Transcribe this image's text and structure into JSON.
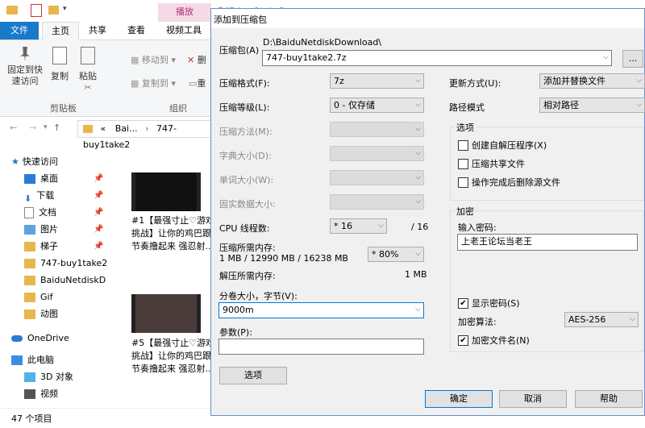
{
  "explorer": {
    "window_title": "747-buy1take2",
    "play_tab": "播放",
    "tabs": [
      "文件",
      "主页",
      "共享",
      "查看",
      "视频工具"
    ],
    "ribbon": {
      "pin": "固定到快\n速访问",
      "copy": "复制",
      "paste": "粘贴",
      "move_to": "移动到",
      "copy_to": "复制到",
      "delete": "删",
      "rename": "重",
      "group_clipboard": "剪贴板",
      "group_organize": "组织"
    },
    "address": [
      "«",
      "Bai...",
      "›",
      "747-buy1take2"
    ],
    "nav": {
      "quick_access": "快速访问",
      "items": [
        "桌面",
        "下载",
        "文档",
        "图片",
        "梯子",
        "747-buy1take2",
        "BaiduNetdiskD",
        "Gif",
        "动图"
      ],
      "onedrive": "OneDrive",
      "this_pc": "此电脑",
      "pc_items": [
        "3D 对象",
        "视频"
      ]
    },
    "files": [
      {
        "caption": "#1【最强寸止♡游戏挑战】让你的鸡巴跟着节奏撸起来 强忍射..."
      },
      {
        "caption": "#5【最强寸止♡游戏挑战】让你的鸡巴跟着节奏撸起来 强忍射..."
      }
    ],
    "status": "47 个项目",
    "colors": {
      "accent": "#1979ca",
      "play_tab_bg": "#f5d9e6",
      "play_tab_fg": "#b52d73"
    }
  },
  "dialog": {
    "title": "添加到压缩包",
    "archive_label": "压缩包(A)",
    "archive_path": "D:\\BaiduNetdiskDownload\\",
    "archive_name": "747-buy1take2.7z",
    "browse": "...",
    "format_label": "压缩格式(F):",
    "format_value": "7z",
    "level_label": "压缩等级(L):",
    "level_value": "0 - 仅存储",
    "method_label": "压缩方法(M):",
    "dict_label": "字典大小(D):",
    "word_label": "单词大小(W):",
    "solid_label": "固实数据大小:",
    "threads_label": "CPU 线程数:",
    "threads_value": "* 16",
    "threads_max": "/ 16",
    "mem_comp_label": "压缩所需内存:",
    "mem_comp_value": "1 MB / 12990 MB / 16238 MB",
    "mem_percent": "* 80%",
    "mem_decomp_label": "解压所需内存:",
    "mem_decomp_value": "1 MB",
    "split_label": "分卷大小，字节(V):",
    "split_value": "9000m",
    "params_label": "参数(P):",
    "params_value": "",
    "options_button": "选项",
    "update_label": "更新方式(U):",
    "update_value": "添加并替换文件",
    "path_label": "路径模式",
    "path_value": "相对路径",
    "options_group": "选项",
    "opt_sfx": "创建自解压程序(X)",
    "opt_shared": "压缩共享文件",
    "opt_delete": "操作完成后删除源文件",
    "enc_group": "加密",
    "pwd_label": "输入密码:",
    "pwd_value": "上老王论坛当老王",
    "show_pwd": "显示密码(S)",
    "enc_method_label": "加密算法:",
    "enc_method_value": "AES-256",
    "enc_names": "加密文件名(N)",
    "ok": "确定",
    "cancel": "取消",
    "help": "帮助",
    "arrow": "⌵",
    "check": "✔"
  }
}
